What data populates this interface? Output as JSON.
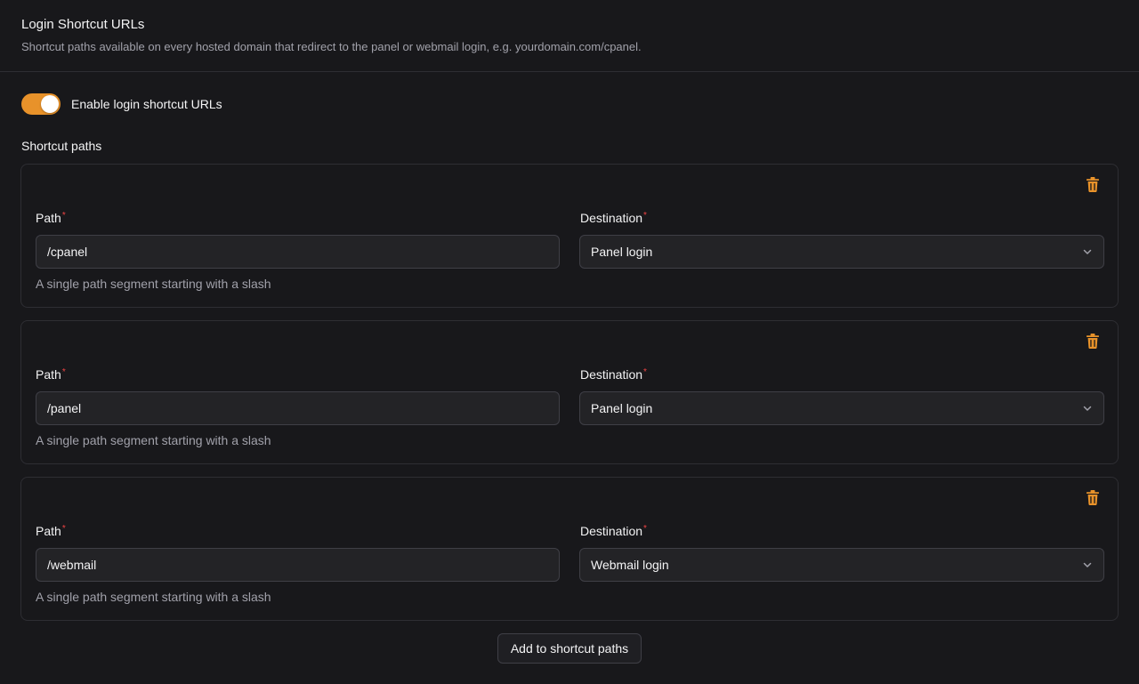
{
  "header": {
    "title": "Login Shortcut URLs",
    "description": "Shortcut paths available on every hosted domain that redirect to the panel or webmail login, e.g. yourdomain.com/cpanel."
  },
  "toggle": {
    "label": "Enable login shortcut URLs",
    "enabled": true,
    "on_color": "#e8922a"
  },
  "shortcuts": {
    "group_label": "Shortcut paths",
    "path_label": "Path",
    "destination_label": "Destination",
    "required_marker": "*",
    "hint": "A single path segment starting with a slash",
    "items": [
      {
        "path": "/cpanel",
        "destination": "Panel login"
      },
      {
        "path": "/panel",
        "destination": "Panel login"
      },
      {
        "path": "/webmail",
        "destination": "Webmail login"
      }
    ],
    "trash_icon": "trash-icon",
    "accent_color": "#e8922a"
  },
  "add_button": {
    "label": "Add to shortcut paths"
  }
}
